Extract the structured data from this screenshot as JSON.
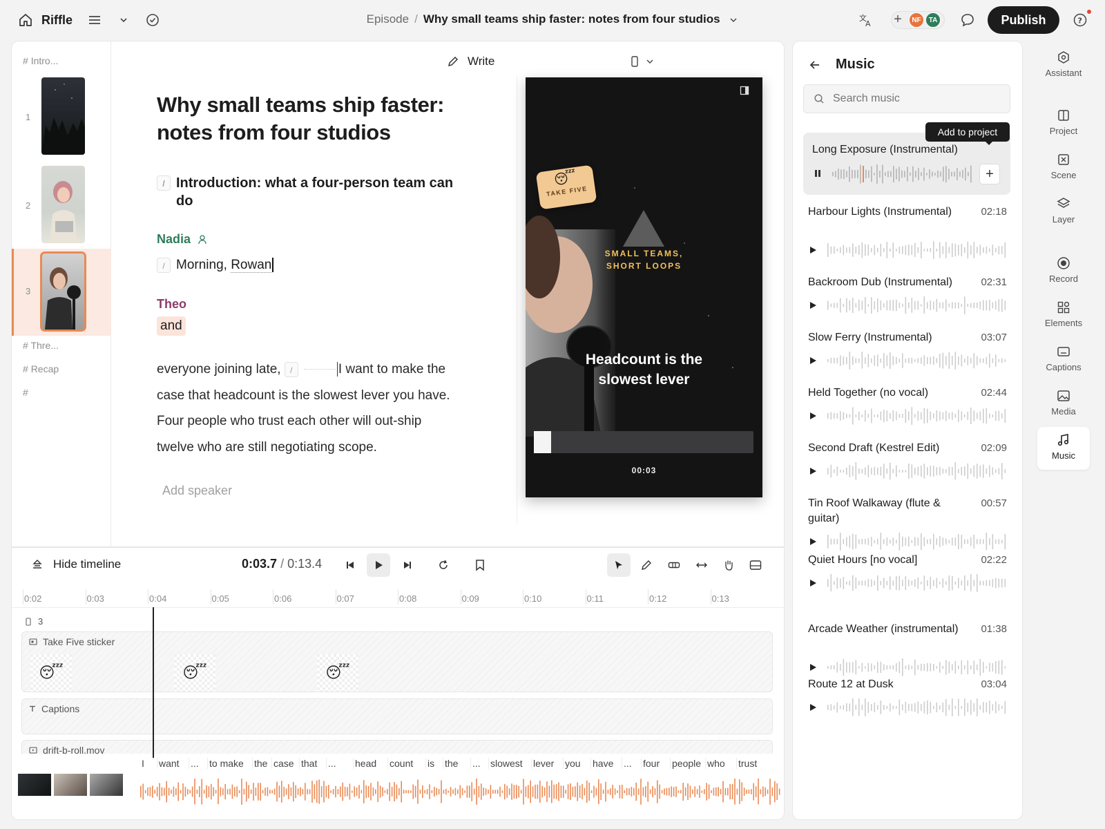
{
  "app": {
    "name": "Riffle"
  },
  "breadcrumb": {
    "parent": "Episode",
    "separator": "/",
    "title": "Why small teams ship faster: notes from four studios"
  },
  "header": {
    "publish_label": "Publish",
    "avatars": [
      "NF",
      "TA"
    ],
    "add_label": "+"
  },
  "colors": {
    "accent": "#e98a55",
    "nadia": "#2e7d5b",
    "theo": "#8b3b6a",
    "publish": "#1c1c1c",
    "highlight": "#fbe4da"
  },
  "editor": {
    "mode_label": "Write",
    "scenes": {
      "headers": [
        "Intro...",
        "Thre...",
        "Recap",
        ""
      ],
      "hash": "#",
      "numbers": [
        "1",
        "2",
        "3"
      ]
    },
    "doc_title": "Why small teams ship faster: notes from four studios",
    "heading": "Introduction: what a four-person team can do",
    "slash": "/",
    "speaker1": "Nadia",
    "line1_a": "Morning, ",
    "line1_b": "Rowan",
    "speaker2": "Theo",
    "line2": "and",
    "para_a": "everyone joining late, ",
    "para_b": "I want to make the case that headcount is the slowest lever you have. Four people who trust each other will out-ship twelve who are still negotiating scope.",
    "add_speaker": "Add speaker"
  },
  "preview": {
    "sticker": "TAKE FIVE",
    "tagline_1": "SMALL TEAMS,",
    "tagline_2": "SHORT LOOPS",
    "caption": "Headcount is the slowest lever",
    "time": "00:03",
    "progress": 0.08
  },
  "timeline": {
    "hide_label": "Hide timeline",
    "current": "0:03.7",
    "separator": "/",
    "total": "0:13.4",
    "ruler": [
      "0:02",
      "0:03",
      "0:04",
      "0:05",
      "0:06",
      "0:07",
      "0:08",
      "0:09",
      "0:10",
      "0:11",
      "0:12",
      "0:13"
    ],
    "scene_label": "3",
    "tracks": [
      "Take Five sticker",
      "Captions",
      "drift-b-roll.mov"
    ],
    "words": [
      "I",
      "want",
      "...",
      "to make",
      "the",
      "case",
      "that",
      "...",
      "head",
      "count",
      "is",
      "the",
      "...",
      "slowest",
      "lever",
      "you",
      "have",
      "...",
      "four",
      "people",
      "who",
      "trust"
    ]
  },
  "music": {
    "title": "Music",
    "search_placeholder": "Search music",
    "tooltip": "Add to project",
    "active_track": "Long Exposure (Instrumental)",
    "add_label": "+",
    "tracks": [
      {
        "title": "Harbour Lights (Instrumental)",
        "duration": "02:18"
      },
      {
        "title": "Backroom Dub (Instrumental)",
        "duration": "02:31"
      },
      {
        "title": "Slow Ferry (Instrumental)",
        "duration": "03:07"
      },
      {
        "title": "Held Together (no vocal)",
        "duration": "02:44"
      },
      {
        "title": "Second Draft (Kestrel Edit)",
        "duration": "02:09"
      },
      {
        "title": "Tin Roof Walkaway (flute & guitar)",
        "duration": "00:57"
      },
      {
        "title": "Quiet Hours [no vocal]",
        "duration": "02:22"
      },
      {
        "title": "Arcade Weather (instrumental)",
        "duration": "01:38"
      },
      {
        "title": "Route 12 at Dusk",
        "duration": "03:04"
      }
    ]
  },
  "rail": [
    {
      "label": "Assistant",
      "icon": "assistant-icon"
    },
    {
      "label": "Project",
      "icon": "project-icon"
    },
    {
      "label": "Scene",
      "icon": "scene-icon"
    },
    {
      "label": "Layer",
      "icon": "layer-icon"
    },
    {
      "label": "Record",
      "icon": "record-icon"
    },
    {
      "label": "Elements",
      "icon": "elements-icon"
    },
    {
      "label": "Captions",
      "icon": "captions-icon"
    },
    {
      "label": "Media",
      "icon": "media-icon"
    },
    {
      "label": "Music",
      "icon": "music-icon"
    }
  ]
}
